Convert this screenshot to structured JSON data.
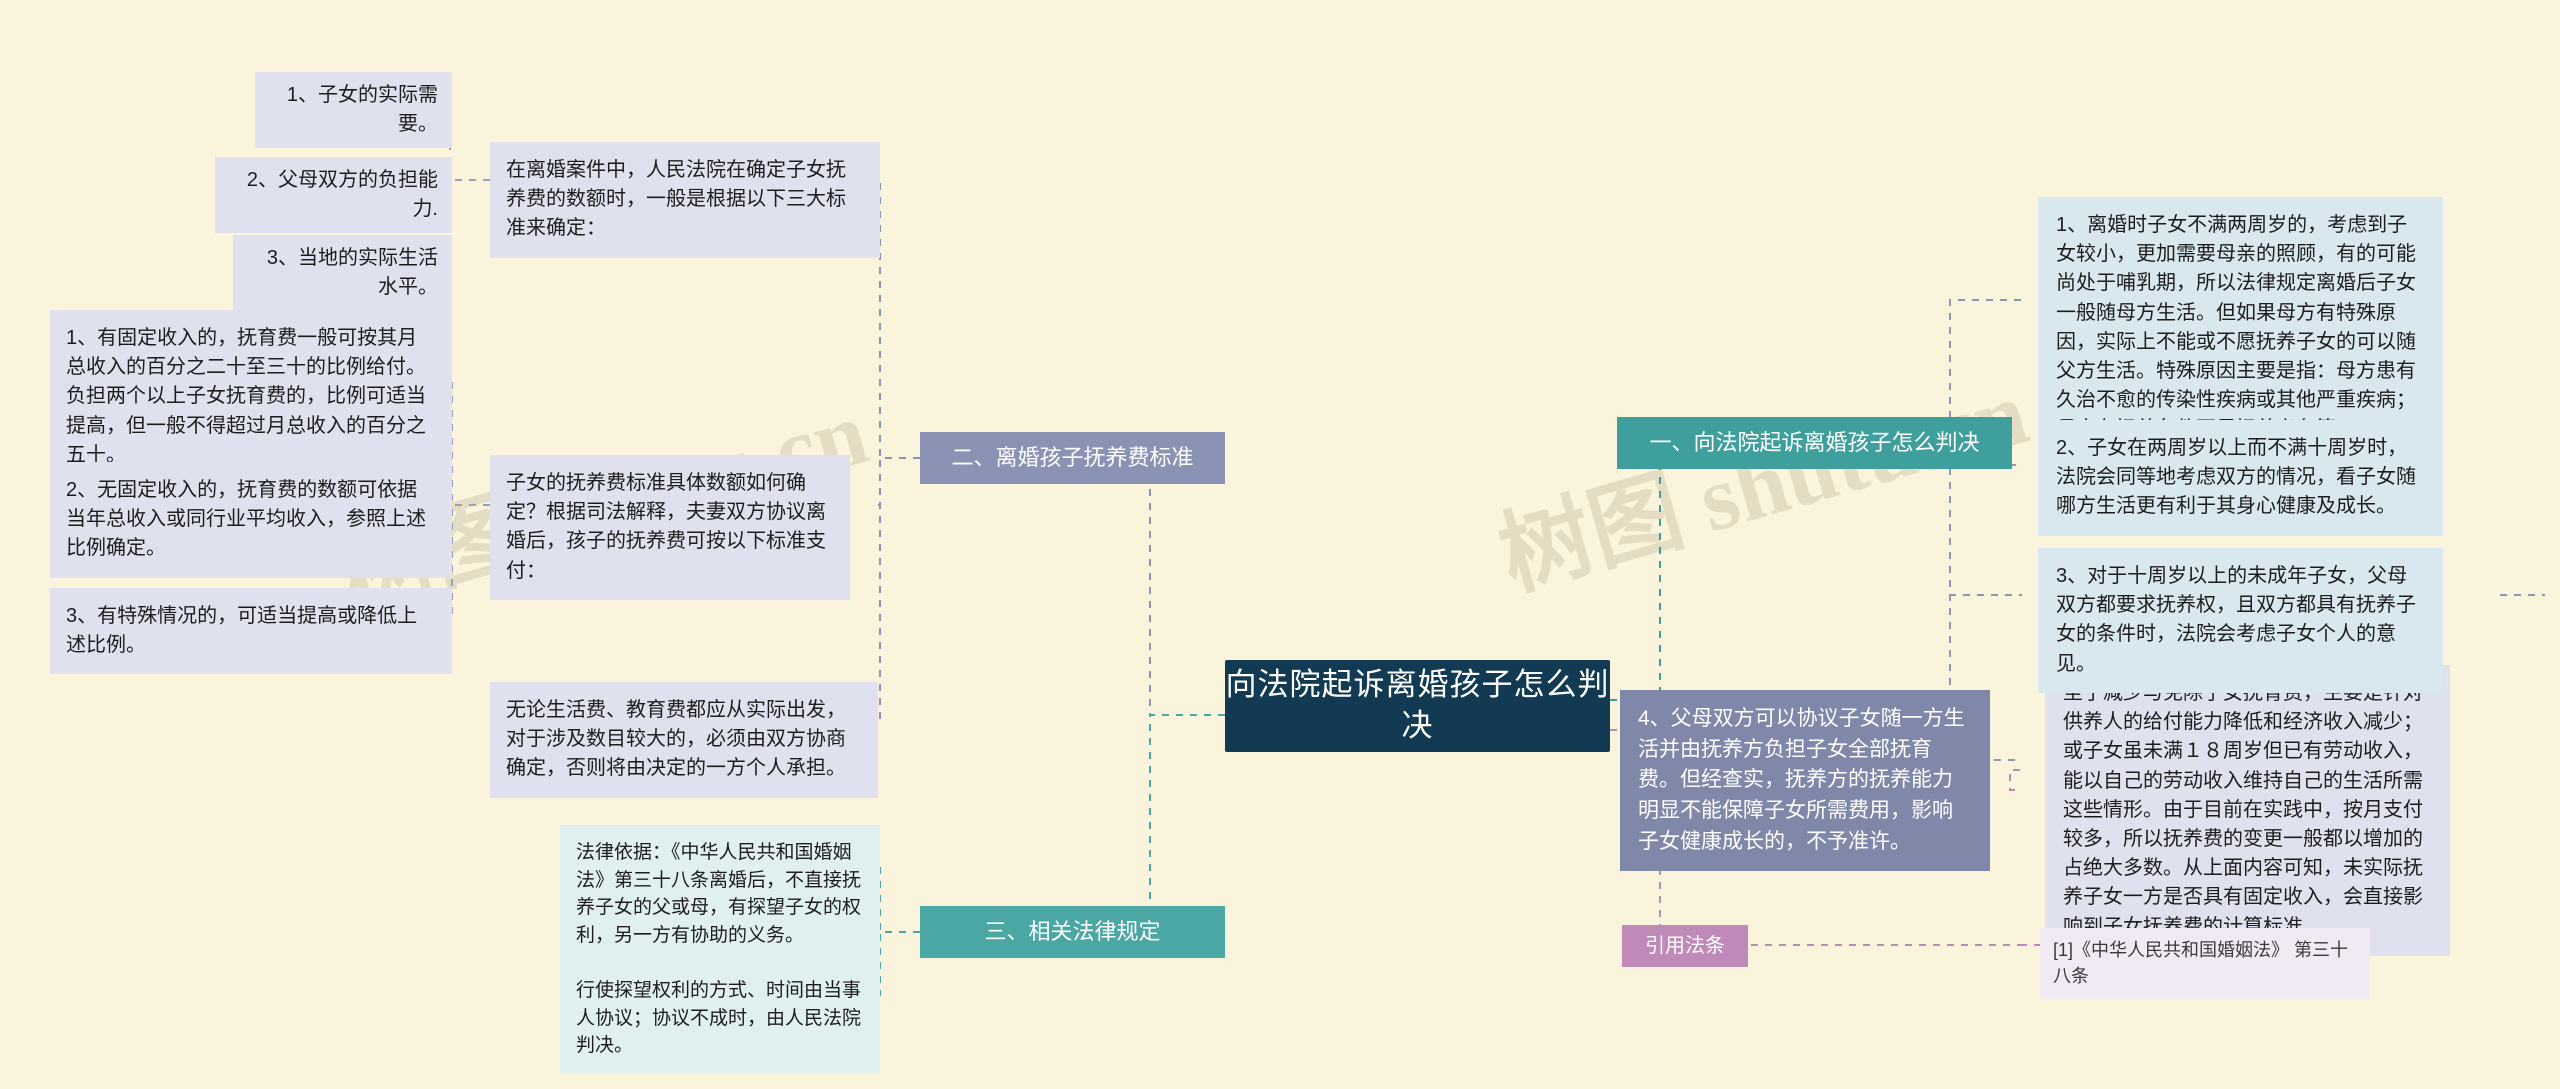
{
  "canvas": {
    "background": "#fbf4dc",
    "watermark_text_left": "树图 shutu.cn",
    "watermark_text_right": "树图 shutu.cn"
  },
  "root": {
    "label": "向法院起诉离婚孩子怎么判决",
    "color": "#123a52"
  },
  "branches": [
    {
      "id": "branch-1",
      "label": "一、向法院起诉离婚孩子怎么判决",
      "color": "#3f9f9d",
      "children": [
        {
          "id": "b1-c1",
          "label": "1、离婚时子女不满两周岁的，考虑到子女较小，更加需要母亲的照顾，有的可能尚处于哺乳期，所以法律规定离婚后子女一般随母方生活。但如果母方有特殊原因，实际上不能或不愿抚养子女的可以随父方生活。特殊原因主要是指：母方患有久治不愈的传染性疾病或其他严重疾病；母方有抚养条件不尽抚养义务等。",
          "color": "#d9e8ee"
        },
        {
          "id": "b1-c2",
          "label": "2、子女在两周岁以上而不满十周岁时，法院会同等地考虑双方的情况，看子女随哪方生活更有利于其身心健康及成长。",
          "color": "#d9e8ee"
        },
        {
          "id": "b1-c3",
          "label": "3、对于十周岁以上的未成年子女，父母双方都要求抚养权，且双方都具有抚养子女的条件时，法院会考虑子女个人的意见。",
          "color": "#d9e8ee"
        },
        {
          "id": "b1-c4",
          "label": "4、父母双方可以协议子女随一方生活并由抚养方负担子女全部抚育费。但经查实，抚养方的抚养能力明显不能保障子女所需费用，影响子女健康成长的，不予准许。",
          "color": "#7f88a8"
        }
      ]
    },
    {
      "id": "branch-2",
      "label": "二、离婚孩子抚养费标准",
      "color": "#8a93b4",
      "intro": "在离婚案件中，人民法院在确定子女抚养费的数额时，一般是根据以下三大标准来确定：",
      "criteria": [
        "1、子女的实际需要。",
        "2、父母双方的负担能力.",
        "3、当地的实际生活水平。"
      ],
      "standard_intro": "子女的抚养费标准具体数额如何确定？根据司法解释，夫妻双方协议离婚后，孩子的抚养费可按以下标准支付：",
      "standards": [
        "1、有固定收入的，抚育费一般可按其月总收入的百分之二十至三十的比例给付。负担两个以上子女抚育费的，比例可适当提高，但一般不得超过月总收入的百分之五十。",
        "2、无固定收入的，抚育费的数额可依据当年总收入或同行业平均收入，参照上述比例确定。",
        "3、有特殊情况的，可适当提高或降低上述比例。"
      ],
      "note": "无论生活费、教育费都应从实际出发，对于涉及数目较大的，必须由双方协商确定，否则将由决定的一方个人承担。",
      "summary": "至于减少与免除子女抚育费，主要是针对供养人的给付能力降低和经济收入减少；或子女虽未满１８周岁但已有劳动收入，能以自己的劳动收入维持自己的生活所需这些情形。由于目前在实践中，按月支付较多，所以抚养费的变更一般都以增加的占绝大多数。从上面内容可知，未实际抚养子女一方是否具有固定收入，会直接影响到子女抚养费的计算标准。"
    },
    {
      "id": "branch-3",
      "label": "三、相关法律规定",
      "color": "#4aa7a4",
      "children": [
        {
          "id": "b3-c1",
          "label": "法律依据：《中华人民共和国婚姻法》第三十八条离婚后，不直接抚养子女的父或母，有探望子女的权利，另一方有协助的义务。",
          "color": "#dff0ef"
        },
        {
          "id": "b3-c2",
          "label": "行使探望权利的方式、时间由当事人协议；协议不成时，由人民法院判决。",
          "color": "#dff0ef"
        }
      ]
    }
  ],
  "citation": {
    "label": "引用法条",
    "color": "#bf8ab8",
    "entry": "[1]《中华人民共和国婚姻法》 第三十八条",
    "entry_color": "#f1eaf4"
  }
}
